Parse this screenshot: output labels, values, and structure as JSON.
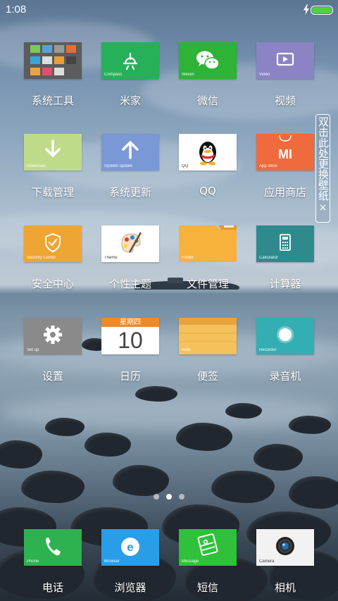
{
  "status_bar": {
    "time": "1:08",
    "battery_level": 1.0,
    "charging": true,
    "battery_color": "#4fd33a"
  },
  "wallpaper_tip": {
    "text": "双击此处更换壁纸",
    "close": "×"
  },
  "apps": [
    {
      "label": "系统工具",
      "color": "#5c5c5c",
      "icon": "folder-grid-icon",
      "caption": ""
    },
    {
      "label": "米家",
      "color": "#27b05a",
      "icon": "mijia-icon",
      "caption": "Compass"
    },
    {
      "label": "微信",
      "color": "#2db335",
      "icon": "wechat-icon",
      "caption": "Weixin"
    },
    {
      "label": "视频",
      "color": "#8a84c4",
      "icon": "video-icon",
      "caption": "Video"
    },
    {
      "label": "下载管理",
      "color": "#bedb8a",
      "icon": "download-icon",
      "caption": "Download"
    },
    {
      "label": "系统更新",
      "color": "#7b98d6",
      "icon": "system-update-icon",
      "caption": "System update"
    },
    {
      "label": "QQ",
      "color": "#ffffff",
      "icon": "qq-penguin-icon",
      "caption": "QQ"
    },
    {
      "label": "应用商店",
      "color": "#ef6a3c",
      "icon": "mi-store-icon",
      "caption": "App store"
    },
    {
      "label": "安全中心",
      "color": "#efa534",
      "icon": "shield-icon",
      "caption": "Security Center"
    },
    {
      "label": "个性主题",
      "color": "#ffffff",
      "icon": "palette-icon",
      "caption": "Theme"
    },
    {
      "label": "文件管理",
      "color": "#f6b23b",
      "icon": "folder-icon",
      "caption": "Folder"
    },
    {
      "label": "计算器",
      "color": "#2f8a8e",
      "icon": "calculator-icon",
      "caption": "Calculator"
    },
    {
      "label": "设置",
      "color": "#8a8a8a",
      "icon": "gear-icon",
      "caption": "Set up"
    },
    {
      "label": "日历",
      "color": "#ffffff",
      "icon": "calendar-icon",
      "caption": "",
      "weekday": "星期四",
      "day": "10"
    },
    {
      "label": "便签",
      "color": "#f5c15a",
      "icon": "notes-icon",
      "caption": "Note"
    },
    {
      "label": "录音机",
      "color": "#33aeb3",
      "icon": "recorder-icon",
      "caption": "Recorder"
    }
  ],
  "page_indicator": {
    "count": 3,
    "active": 1
  },
  "dock": [
    {
      "label": "电话",
      "color": "#2eb14f",
      "icon": "phone-icon",
      "caption": "Phone"
    },
    {
      "label": "浏览器",
      "color": "#2a9de8",
      "icon": "browser-icon",
      "caption": "Browser"
    },
    {
      "label": "短信",
      "color": "#2fc13b",
      "icon": "message-icon",
      "caption": "Message"
    },
    {
      "label": "相机",
      "color": "#f2f2f2",
      "icon": "camera-icon",
      "caption": "Camera"
    }
  ]
}
